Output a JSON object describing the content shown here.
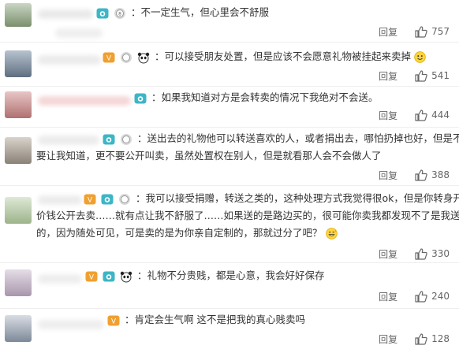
{
  "comments": [
    {
      "text": "：不一定生气，但心里会不舒服",
      "reply": "回复",
      "likes": "757"
    },
    {
      "text": "：可以接受朋友处置，但是应该不会愿意礼物被挂起来卖掉",
      "reply": "回复",
      "likes": "541"
    },
    {
      "text": "：如果我知道对方是会转卖的情况下我绝对不会送。",
      "reply": "回复",
      "likes": "444"
    },
    {
      "lines": [
        "：送出去的礼物他可以转送喜欢的人，或者捐出去，哪怕扔掉也好，但是不",
        "要让我知道，更不要公开叫卖，虽然处置权在别人，但是就看那人会不会做人了"
      ],
      "reply": "回复",
      "likes": "388"
    },
    {
      "lines": [
        "：我可以接受捐赠，转送之类的，这种处理方式我觉得很ok，但是你转身开个",
        "价钱公开去卖……就有点让我不舒服了……如果送的是路边买的，很可能你卖我都发现不了是我送",
        "的，因为随处可见，可是卖的是为你亲自定制的，那就过分了吧？"
      ],
      "reply": "回复",
      "likes": "330"
    },
    {
      "text": "：礼物不分贵贱，都是心意，我会好好保存",
      "reply": "回复",
      "likes": "240"
    },
    {
      "text": "：肯定会生气啊 这不是把我的真心贱卖吗",
      "reply": "回复",
      "likes": "128"
    }
  ],
  "colors": {
    "text": "#333333",
    "muted": "#666666",
    "badge_teal": "#3cb6c6",
    "badge_orange": "#f0a030",
    "divider": "#eeeeee"
  }
}
